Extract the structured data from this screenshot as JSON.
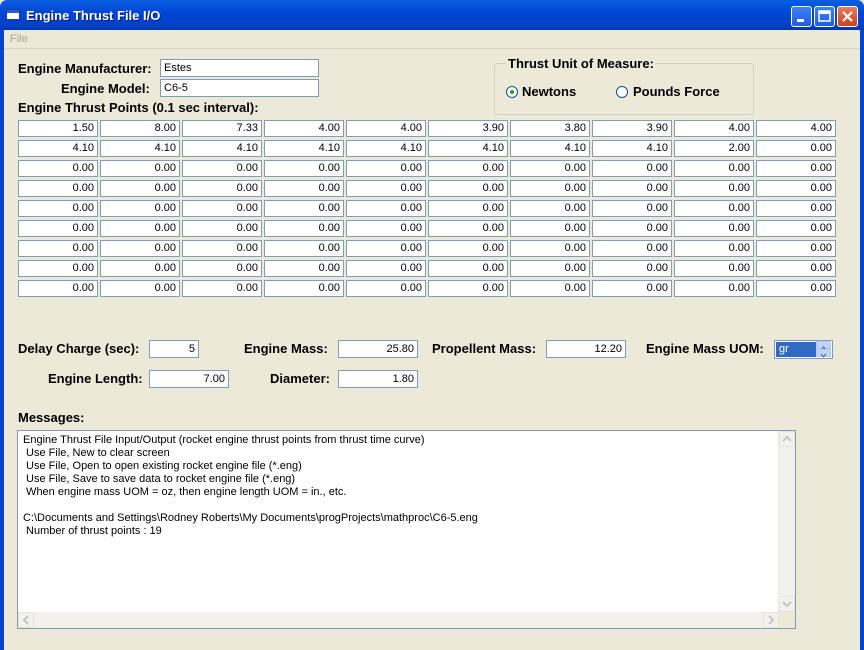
{
  "window": {
    "title": "Engine Thrust File I/O"
  },
  "menu": {
    "file": "File"
  },
  "labels": {
    "manufacturer": "Engine Manufacturer:",
    "model": "Engine Model:",
    "thrust_points": "Engine Thrust Points (0.1 sec interval):",
    "delay": "Delay Charge (sec):",
    "engine_mass": "Engine Mass:",
    "propellent_mass": "Propellent Mass:",
    "mass_uom": "Engine Mass UOM:",
    "engine_length": "Engine Length:",
    "diameter": "Diameter:",
    "messages": "Messages:"
  },
  "fields": {
    "manufacturer": "Estes",
    "model": "C6-5",
    "delay": "5",
    "engine_mass": "25.80",
    "propellent_mass": "12.20",
    "mass_uom": "gr",
    "engine_length": "7.00",
    "diameter": "1.80"
  },
  "unit_group": {
    "title": "Thrust Unit of Measure:",
    "options": [
      "Newtons",
      "Pounds Force"
    ],
    "selected": "Newtons"
  },
  "grid": [
    [
      "1.50",
      "8.00",
      "7.33",
      "4.00",
      "4.00",
      "3.90",
      "3.80",
      "3.90",
      "4.00",
      "4.00"
    ],
    [
      "4.10",
      "4.10",
      "4.10",
      "4.10",
      "4.10",
      "4.10",
      "4.10",
      "4.10",
      "2.00",
      "0.00"
    ],
    [
      "0.00",
      "0.00",
      "0.00",
      "0.00",
      "0.00",
      "0.00",
      "0.00",
      "0.00",
      "0.00",
      "0.00"
    ],
    [
      "0.00",
      "0.00",
      "0.00",
      "0.00",
      "0.00",
      "0.00",
      "0.00",
      "0.00",
      "0.00",
      "0.00"
    ],
    [
      "0.00",
      "0.00",
      "0.00",
      "0.00",
      "0.00",
      "0.00",
      "0.00",
      "0.00",
      "0.00",
      "0.00"
    ],
    [
      "0.00",
      "0.00",
      "0.00",
      "0.00",
      "0.00",
      "0.00",
      "0.00",
      "0.00",
      "0.00",
      "0.00"
    ],
    [
      "0.00",
      "0.00",
      "0.00",
      "0.00",
      "0.00",
      "0.00",
      "0.00",
      "0.00",
      "0.00",
      "0.00"
    ],
    [
      "0.00",
      "0.00",
      "0.00",
      "0.00",
      "0.00",
      "0.00",
      "0.00",
      "0.00",
      "0.00",
      "0.00"
    ],
    [
      "0.00",
      "0.00",
      "0.00",
      "0.00",
      "0.00",
      "0.00",
      "0.00",
      "0.00",
      "0.00",
      "0.00"
    ]
  ],
  "messages": [
    "Engine Thrust File Input/Output (rocket engine thrust points from thrust time curve)",
    " Use File, New to clear screen",
    " Use File, Open to open existing rocket engine file (*.eng)",
    " Use File, Save to save data to rocket engine file (*.eng)",
    " When engine mass UOM = oz, then engine length UOM = in., etc.",
    "",
    "C:\\Documents and Settings\\Rodney Roberts\\My Documents\\progProjects\\mathproc\\C6-5.eng",
    " Number of thrust points : 19"
  ]
}
